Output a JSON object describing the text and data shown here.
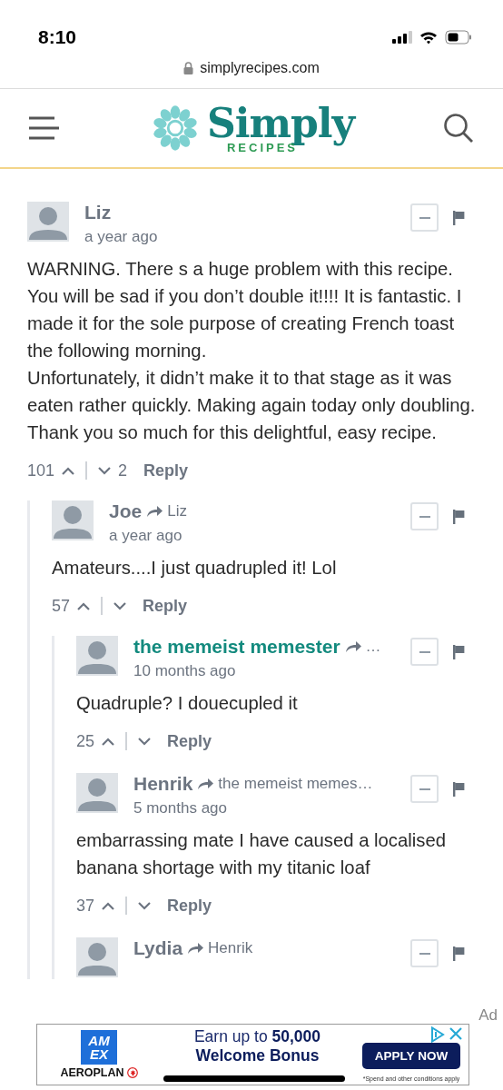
{
  "status_bar": {
    "time": "8:10"
  },
  "address_bar": {
    "url": "simplyrecipes.com"
  },
  "site_header": {
    "logo_word": "Simply",
    "logo_subword": "RECIPES"
  },
  "comments": [
    {
      "author": "Liz",
      "highlighted": false,
      "time": "a year ago",
      "text": "WARNING. There s a huge problem with this recipe. You will be sad if you don’t double it!!!! It is fantastic. I made it for the sole purpose of creating French toast the following morning.\nUnfortunately, it didn’t make it to that stage as it was eaten rather quickly. Making again today only doubling.\nThank you so much for this delightful, easy recipe.",
      "upvotes": "101",
      "downvotes": "2",
      "reply_label": "Reply",
      "children": [
        {
          "author": "Joe",
          "reply_to": "Liz",
          "highlighted": false,
          "time": "a year ago",
          "text": "Amateurs....I just quadrupled it! Lol",
          "upvotes": "57",
          "reply_label": "Reply",
          "children": [
            {
              "author": "the memeist memester",
              "reply_to": "…",
              "highlighted": true,
              "time": "10 months ago",
              "text": "Quadruple? I douecupled it",
              "upvotes": "25",
              "reply_label": "Reply"
            },
            {
              "author": "Henrik",
              "reply_to": "the memeist memes…",
              "highlighted": false,
              "time": "5 months ago",
              "text": "embarrassing mate I have caused a localised banana shortage with my titanic loaf",
              "upvotes": "37",
              "reply_label": "Reply"
            },
            {
              "author": "Lydia",
              "reply_to": "Henrik",
              "highlighted": false
            }
          ]
        }
      ]
    }
  ],
  "ad": {
    "label": "Ad",
    "logo_top": "AM",
    "logo_bottom": "EX",
    "brand": "AEROPLAN",
    "headline": "Earn up to **50,000**",
    "subheadline": "Welcome Bonus",
    "button": "APPLY NOW",
    "fine_print": "*Spend and other conditions apply"
  }
}
